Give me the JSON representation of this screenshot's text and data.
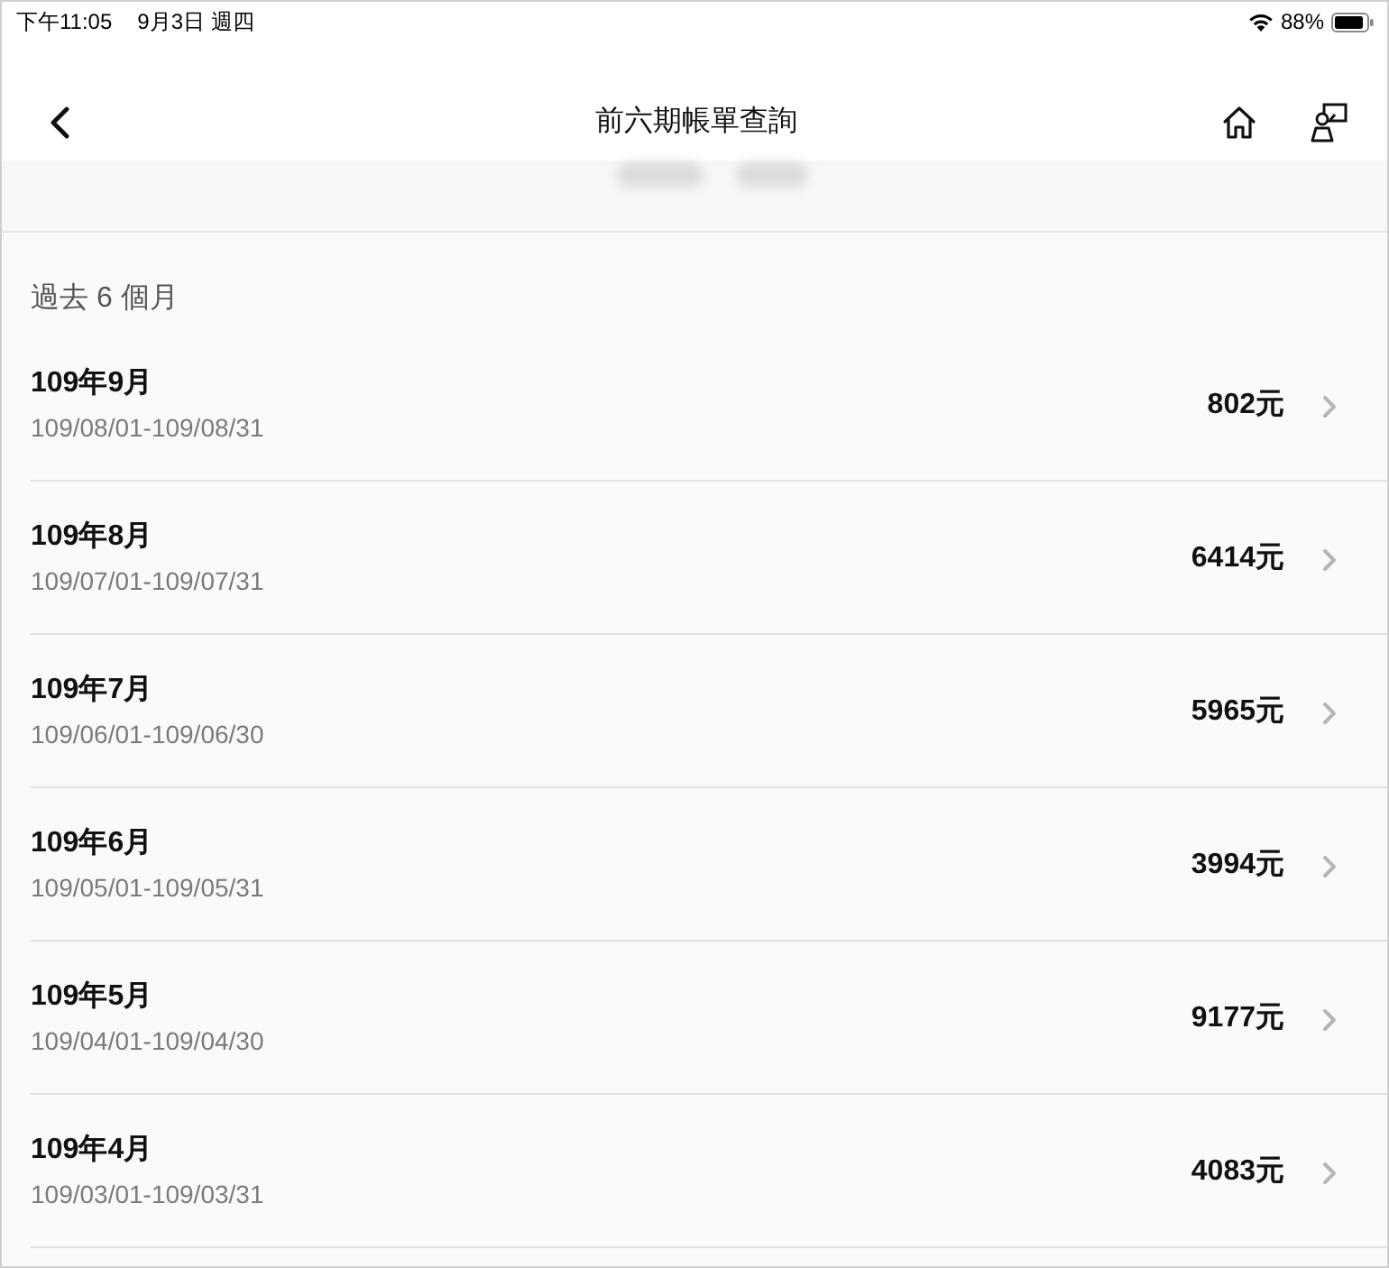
{
  "status_bar": {
    "time": "下午11:05",
    "date": "9月3日 週四",
    "battery": "88%"
  },
  "nav": {
    "title": "前六期帳單查詢"
  },
  "section": {
    "header": "過去 6 個月"
  },
  "bills": [
    {
      "month": "109年9月",
      "period": "109/08/01-109/08/31",
      "amount": "802元"
    },
    {
      "month": "109年8月",
      "period": "109/07/01-109/07/31",
      "amount": "6414元"
    },
    {
      "month": "109年7月",
      "period": "109/06/01-109/06/30",
      "amount": "5965元"
    },
    {
      "month": "109年6月",
      "period": "109/05/01-109/05/31",
      "amount": "3994元"
    },
    {
      "month": "109年5月",
      "period": "109/04/01-109/04/30",
      "amount": "9177元"
    },
    {
      "month": "109年4月",
      "period": "109/03/01-109/03/31",
      "amount": "4083元"
    }
  ]
}
